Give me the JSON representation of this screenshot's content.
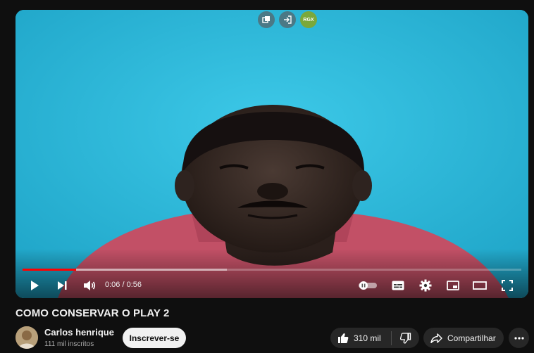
{
  "video": {
    "title": "COMO CONSERVAR O PLAY 2",
    "current_time": "0:06",
    "duration": "0:56",
    "time_display": "0:06 / 0:56",
    "progress_fraction": 0.107,
    "buffered_fraction": 0.41
  },
  "extensions": {
    "rgx_label": "RGX"
  },
  "channel": {
    "name": "Carlos henrique",
    "subscribers": "111 mil inscritos"
  },
  "actions": {
    "subscribe_label": "Inscrever-se",
    "like_count": "310 mil",
    "share_label": "Compartilhar"
  },
  "icons": {
    "play": "play-icon",
    "next": "next-icon",
    "volume": "volume-icon",
    "autoplay": "autoplay-toggle",
    "subtitles": "subtitles-icon",
    "settings": "gear-icon",
    "miniplayer": "miniplayer-icon",
    "theater": "theater-icon",
    "fullscreen": "fullscreen-icon",
    "like": "thumbs-up-icon",
    "dislike": "thumbs-down-icon",
    "share": "share-icon",
    "more": "more-icon"
  },
  "colors": {
    "progress": "#ff0000",
    "background": "#0f0f0f",
    "video_backdrop": "#2ab7d7"
  }
}
